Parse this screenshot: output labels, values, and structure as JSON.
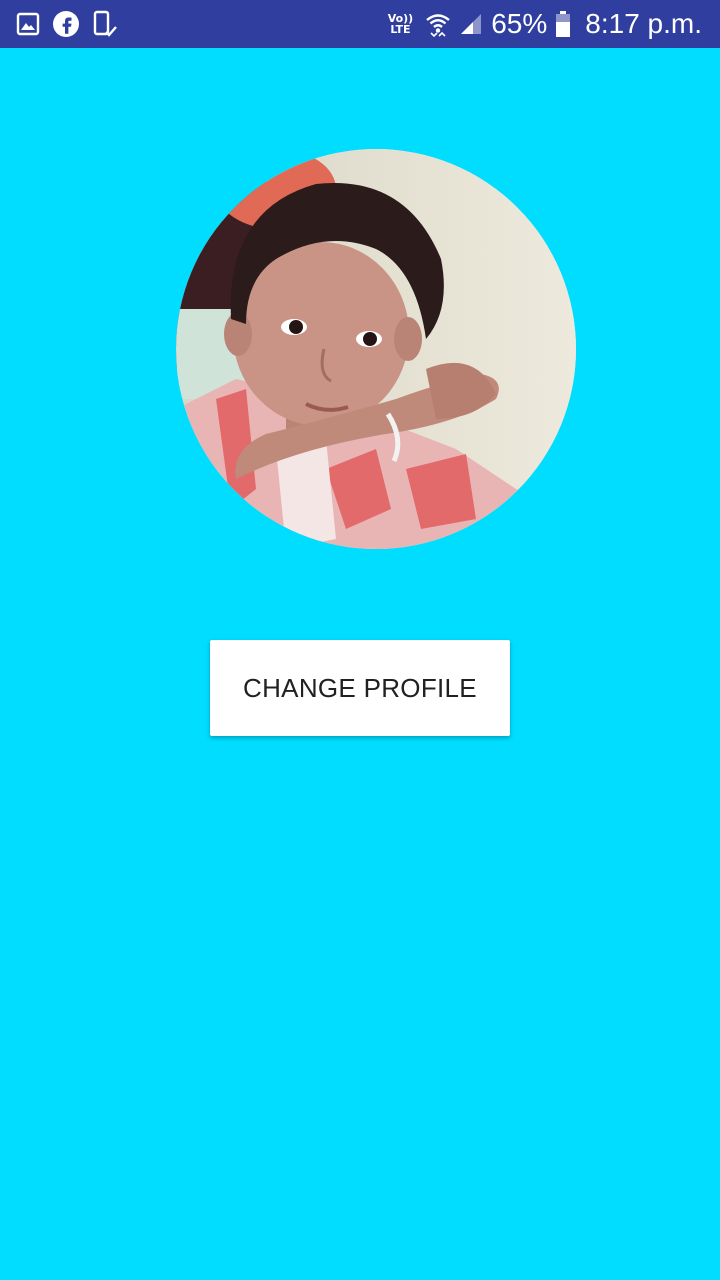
{
  "status_bar": {
    "left_icons": [
      "gallery-notification-icon",
      "fb-lite-notification-icon",
      "device-check-notification-icon"
    ],
    "volte_top": "Vo))",
    "volte_bottom": "LTE",
    "battery_percent": "65%",
    "time": "8:17 p.m."
  },
  "profile": {
    "avatar_icon": "profile-photo",
    "change_button_label": "CHANGE PROFILE"
  },
  "colors": {
    "status_bar": "#303F9F",
    "background": "#00DDFF",
    "button": "#FFFFFF",
    "button_text": "#212121"
  }
}
